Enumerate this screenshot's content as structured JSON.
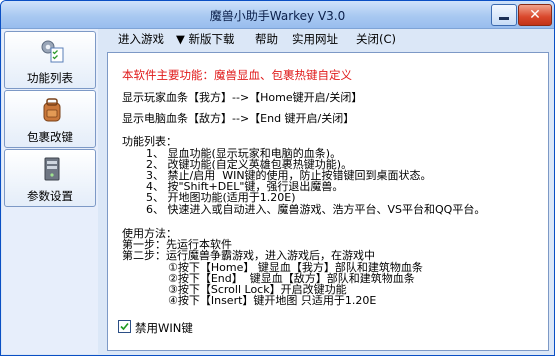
{
  "window": {
    "title": "魔兽小助手Warkey V3.0"
  },
  "sidebar": {
    "items": [
      {
        "label": "功能列表",
        "icon": "settings-checklist-icon"
      },
      {
        "label": "包裹改键",
        "icon": "backpack-icon"
      },
      {
        "label": "参数设置",
        "icon": "server-icon"
      }
    ]
  },
  "menu": {
    "items": [
      "进入游戏",
      "▼ 新版下载",
      "帮助",
      "实用网址",
      "关闭(C)"
    ]
  },
  "content": {
    "headline": "本软件主要功能：魔兽显血、包裹热键自定义",
    "line_ally": "显示玩家血条【我方】-->【Home键开启/关闭】",
    "line_enemy": "显示电脑血条【敌方】-->【End 键开启/关闭】",
    "features_title": "功能列表：",
    "features": [
      "1、 显血功能(显示玩家和电脑的血条)。",
      "2、 改键功能(自定义英雄包裹热键功能)。",
      "3、 禁止/启用  WIN键的使用，防止按错键回到桌面状态。",
      "4、 按\"Shift+DEL\"键，强行退出魔兽。",
      "5、 开地图功能(适用于1.20E)",
      "6、 快速进入或自动进入、魔兽游戏、浩方平台、VS平台和QQ平台。"
    ],
    "usage_title": "使用方法：",
    "step1": "第一步：先运行本软件",
    "step2": "第二步：运行魔兽争霸游戏，进入游戏后，在游戏中",
    "substeps": [
      "①按下【Home】 键显血【我方】部队和建筑物血条",
      "②按下【End】  键显血【敌方】部队和建筑物血条",
      "③按下【Scroll Lock】开启改键功能",
      "④按下【Insert】键开地图 只适用于1.20E"
    ],
    "checkbox_label": "禁用WIN键",
    "checkbox_checked": true
  }
}
